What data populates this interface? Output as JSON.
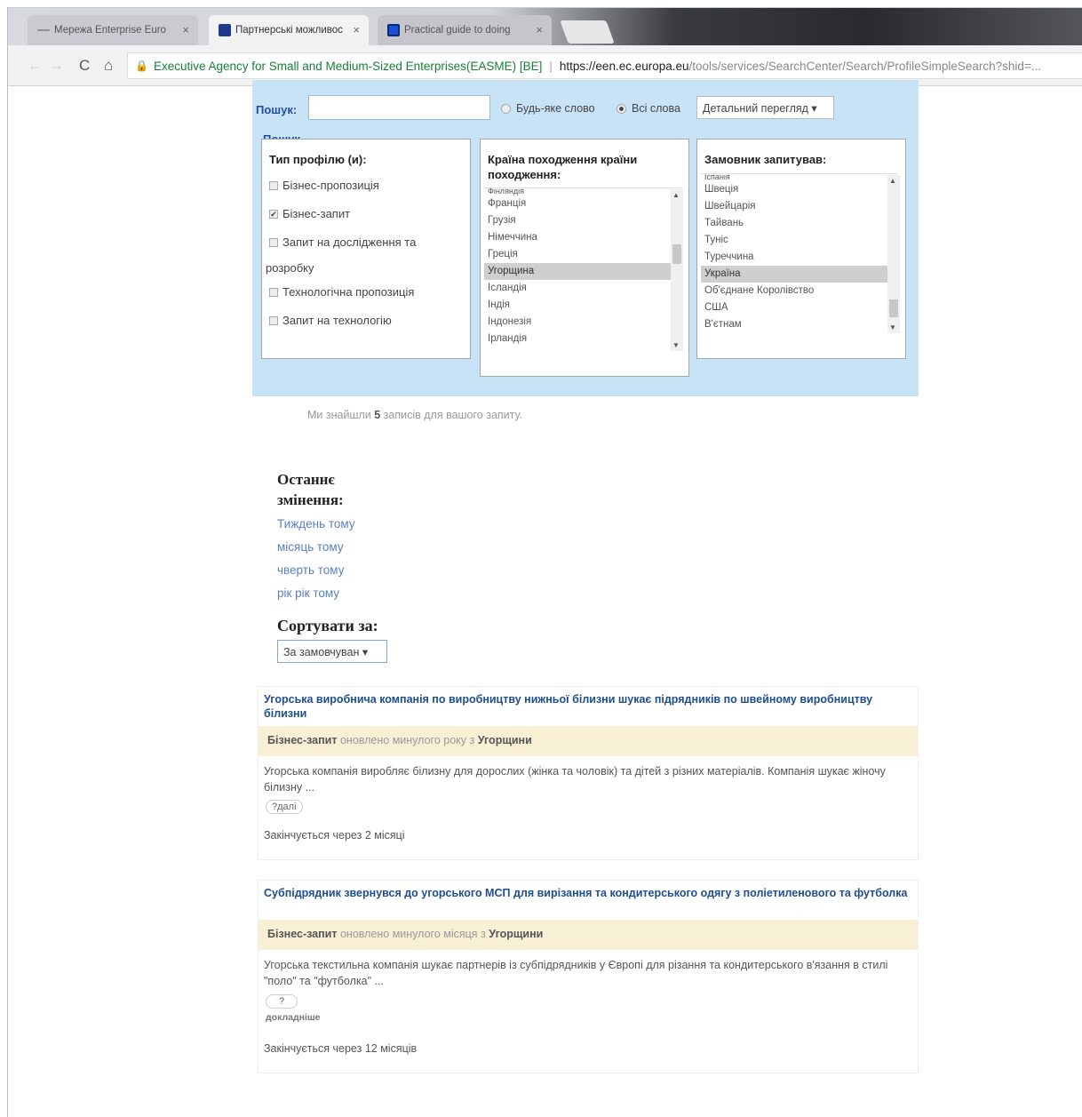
{
  "browser": {
    "tabs": [
      {
        "title": "Мережа Enterprise Euro",
        "close": "×"
      },
      {
        "title": "Партнерські можливос",
        "close": "×"
      },
      {
        "title": "Practical guide to doing",
        "close": "×"
      }
    ],
    "nav": {
      "back": "←",
      "forward": "→",
      "reload": "C",
      "home": "⌂"
    },
    "address": {
      "lock": "🔒",
      "origin": "Executive Agency for Small and Medium-Sized Enterprises(EASME) [BE]",
      "separator": "|",
      "host": "https://een.ec.europa.eu",
      "path": "/tools/services/SearchCenter/Search/ProfileSimpleSearch?shid=..."
    }
  },
  "search": {
    "label": "Пошук:",
    "input_value": "",
    "radio_any": "Будь-яке слово",
    "radio_all": "Всі слова",
    "view_select": "Детальний перегляд ▾",
    "fieldset_legend": "Пошук",
    "profile_type": {
      "heading": "Тип профілю (и):",
      "options": [
        {
          "label": "Бізнес-пропозиція",
          "checked": false
        },
        {
          "label": "Бізнес-запит",
          "checked": true
        },
        {
          "label": "Запит на дослідження та",
          "checked": false
        },
        {
          "label": "Технологічна пропозиція",
          "checked": false
        },
        {
          "label": "Запит на технологію",
          "checked": false
        }
      ],
      "wrap_text": "розробку"
    },
    "country_origin": {
      "heading": "Країна походження країни походження:",
      "items": [
        "Фінляндія",
        "Франція",
        "Грузія",
        "Німеччина",
        "Греція",
        "Угорщина",
        "Ісландія",
        "Індія",
        "Індонезія",
        "Ірландія"
      ],
      "selected": "Угорщина"
    },
    "requester": {
      "heading": "Замовник запитував:",
      "items": [
        "Іспанія",
        "Швеція",
        "Швейцарія",
        "Тайвань",
        "Туніс",
        "Туреччина",
        "Україна",
        "Об'єднане Королівство",
        "США",
        "В'єтнам"
      ],
      "selected": "Україна"
    }
  },
  "results": {
    "found_prefix": "Ми знайшли",
    "found_count": "5",
    "found_suffix": "записів для вашого запиту."
  },
  "recent": {
    "heading": "Останнє змінення:",
    "links": [
      "Тиждень тому",
      "місяць тому",
      "чверть тому",
      "рік рік тому"
    ]
  },
  "sort": {
    "heading": "Сортувати за:",
    "selected": "За замовчуван ▾"
  },
  "cards": [
    {
      "title": "Угорська виробнича компанія по виробництву нижньої білизни шукає підрядників по швейному виробництву білизни",
      "type": "Бізнес-запит",
      "updated": "оновлено минулого року з",
      "country": "Угорщини",
      "desc": "Угорська компанія виробляє білизну для дорослих (жінка та чоловік) та дітей з різних матеріалів. Компанія шукає жіночу білизну ...",
      "more": "?далі",
      "more_extra": "",
      "expires": "Закінчується через 2 місяці"
    },
    {
      "title": "Субпідрядник звернувся до угорського МСП для вирізання та кондитерського одягу з поліетиленового та футболка",
      "type": "Бізнес-запит",
      "updated": "оновлено минулого місяця з",
      "country": "Угорщини",
      "desc": "Угорська текстильна компанія шукає партнерів із субпідрядників у Європі для різання та кондитерського в'язання в стилі \"поло\" та \"футболка\" ...",
      "more": "?",
      "more_extra": "докладніше",
      "expires": "Закінчується через 12 місяців"
    }
  ],
  "colors": {
    "panel": "#c9e3f6",
    "band": "#f7f0d5",
    "link": "#5a7fc0",
    "title": "#1e4e8e"
  }
}
